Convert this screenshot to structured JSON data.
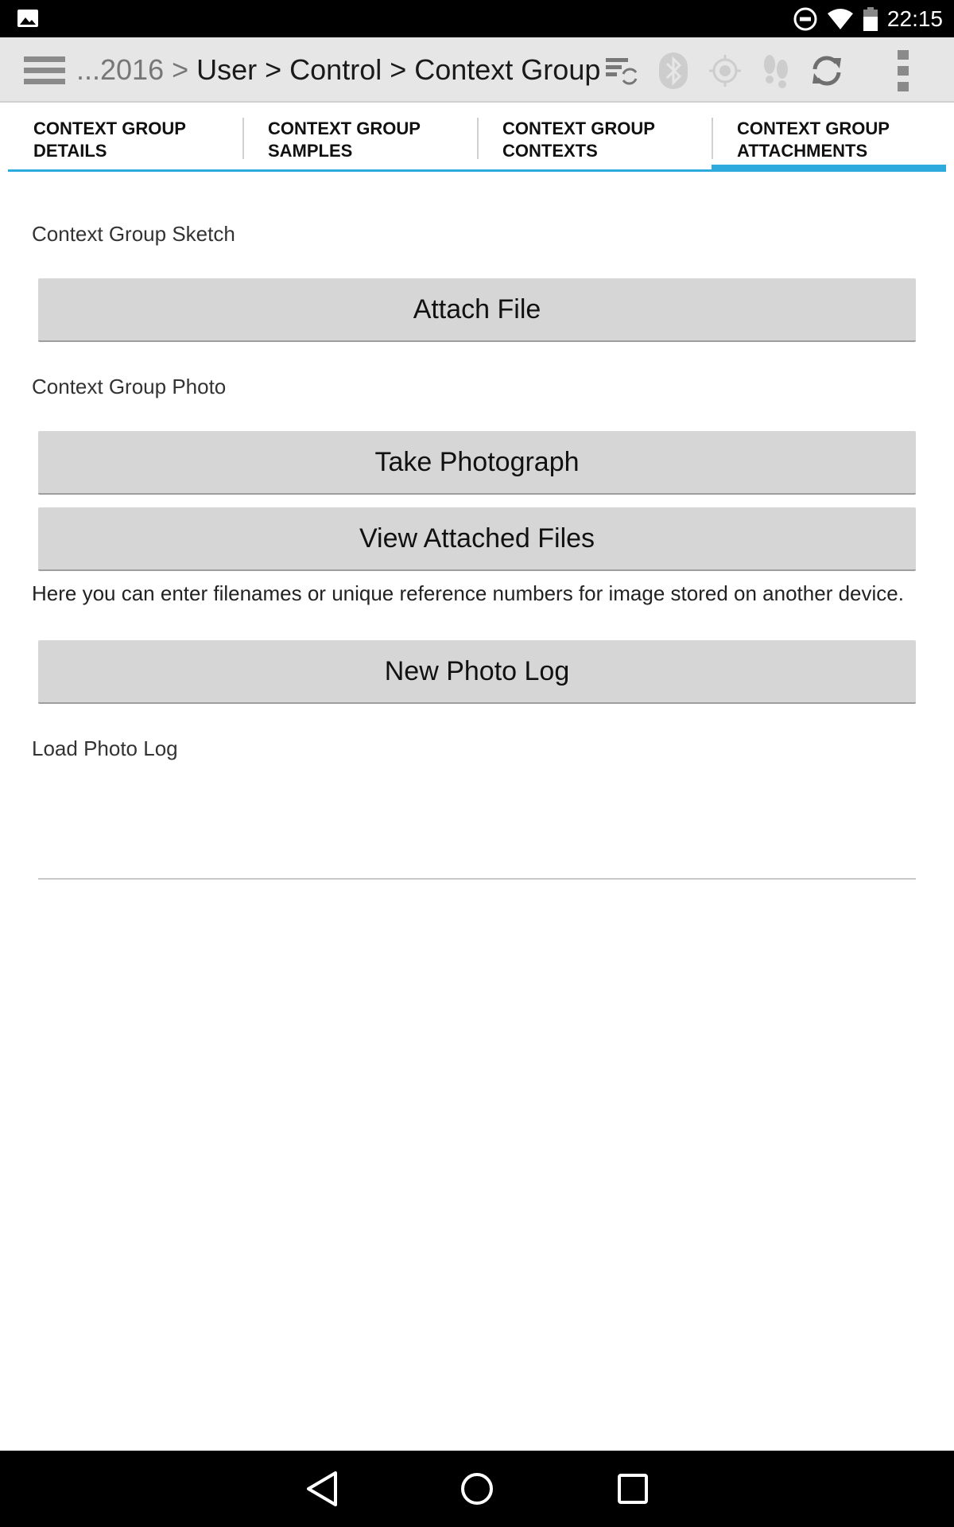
{
  "status_bar": {
    "time": "22:15",
    "icons": [
      "gallery-icon",
      "do-not-disturb-icon",
      "wifi-icon",
      "battery-icon"
    ]
  },
  "action_bar": {
    "breadcrumb_prefix": "...2016 >",
    "breadcrumb_path": "User > Control > Context Group",
    "icons": [
      "menu-icon",
      "sync-settings-icon",
      "bluetooth-icon",
      "gps-icon",
      "footsteps-icon",
      "refresh-icon",
      "overflow-menu-icon"
    ]
  },
  "tabs": [
    {
      "line1": "CONTEXT GROUP",
      "line2": "DETAILS",
      "active": false
    },
    {
      "line1": "CONTEXT GROUP",
      "line2": "SAMPLES",
      "active": false
    },
    {
      "line1": "CONTEXT GROUP",
      "line2": "CONTEXTS",
      "active": false
    },
    {
      "line1": "CONTEXT GROUP",
      "line2": "ATTACHMENTS",
      "active": true
    }
  ],
  "content": {
    "sketch_label": "Context Group Sketch",
    "attach_file_label": "Attach File",
    "photo_label": "Context Group Photo",
    "take_photo_label": "Take Photograph",
    "view_files_label": "View Attached Files",
    "help_text": "Here you can enter filenames or unique reference numbers for image stored on another device.",
    "new_photo_log_label": "New Photo Log",
    "load_photo_log_label": "Load Photo Log",
    "load_photo_log_value": ""
  },
  "nav_bar": {
    "icons": [
      "back-icon",
      "home-icon",
      "recents-icon"
    ]
  },
  "colors": {
    "accent": "#2eaadc",
    "action_bar_bg": "#e6e6e6",
    "button_bg": "#d6d6d6"
  }
}
